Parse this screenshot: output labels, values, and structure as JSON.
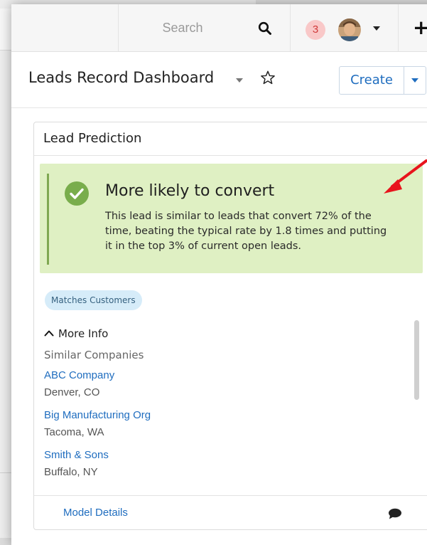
{
  "topbar": {
    "search_placeholder": "Search",
    "notification_count": "3",
    "plus_label": "+",
    "icons": [
      "search-icon",
      "user-avatar",
      "chevron-down-icon",
      "plus-icon"
    ]
  },
  "titlebar": {
    "title": "Leads Record Dashboard",
    "create_label": "Create",
    "icons": [
      "chevron-down-icon",
      "star-icon"
    ]
  },
  "dashlet": {
    "title": "Lead Prediction",
    "prediction": {
      "heading": "More likely to convert",
      "text": "This lead is similar to leads that convert 72% of the time, beating the typical rate by 1.8 times and putting it in the top 3% of current open leads.",
      "icon": "check-circle-icon"
    },
    "tag": "Matches Customers",
    "more_info_label": "More Info",
    "similar_label": "Similar Companies",
    "companies": [
      {
        "name": "ABC Company",
        "location": "Denver, CO"
      },
      {
        "name": "Big Manufacturing Org",
        "location": "Tacoma, WA"
      },
      {
        "name": "Smith & Sons",
        "location": "Buffalo, NY"
      }
    ],
    "footer": {
      "model_details_label": "Model Details",
      "icon": "comment-icon"
    }
  },
  "colors": {
    "link": "#1f6dbf",
    "prediction_bg": "#dff0c3",
    "prediction_bar": "#7fa852",
    "check": "#79ad4c",
    "badge_bg": "#f9c8c8",
    "badge_text": "#d03a3a",
    "tag_bg": "#d6ecf9",
    "annotation_arrow": "#e8141c"
  }
}
